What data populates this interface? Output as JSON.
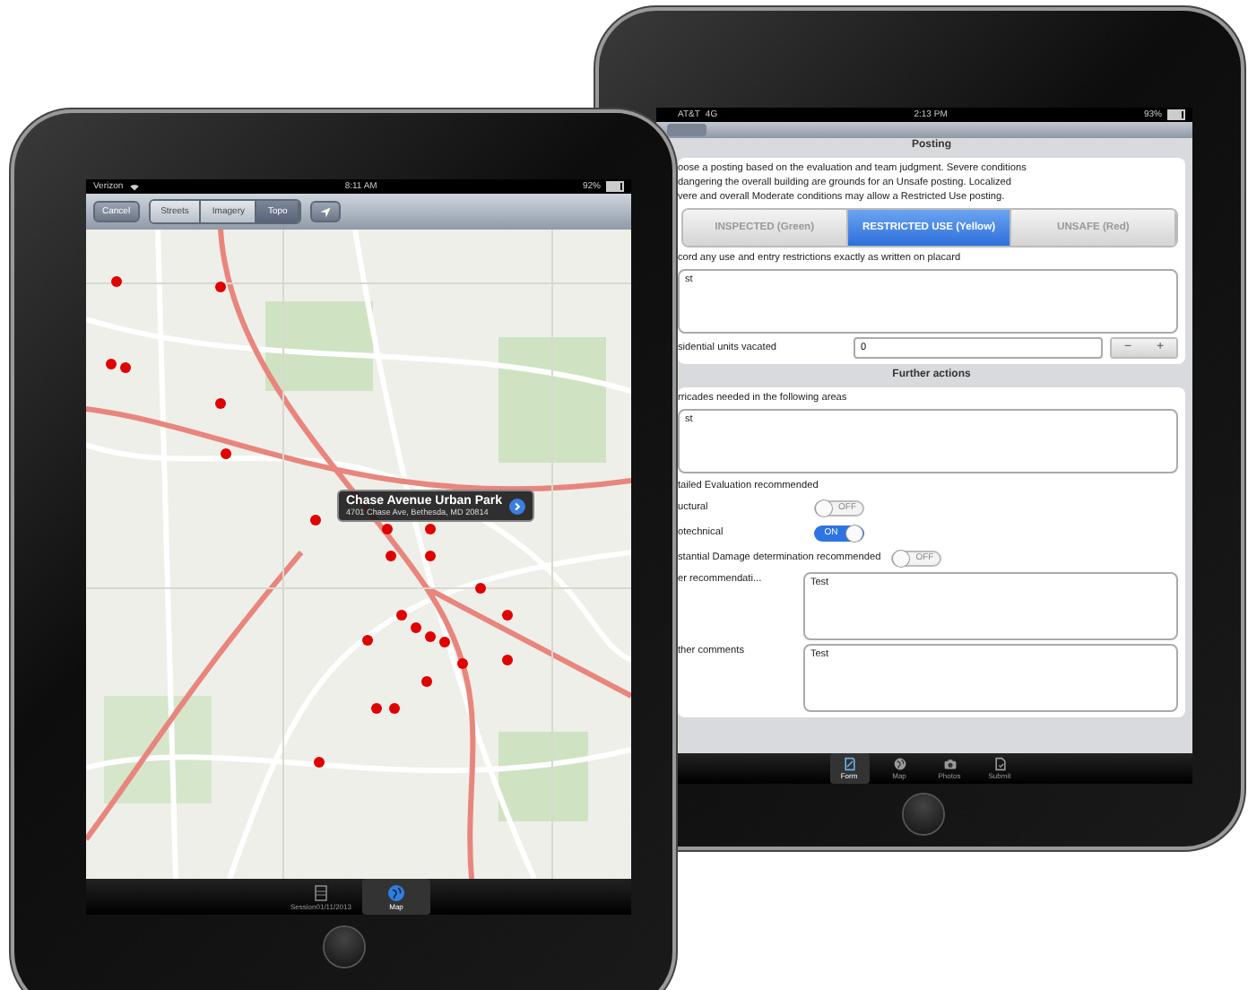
{
  "back_device": {
    "status_bar": {
      "carrier": "AT&T",
      "network": "4G",
      "time": "2:13 PM",
      "battery": "93%"
    },
    "posting": {
      "title": "Posting",
      "instruction_lines": [
        "oose a posting based on the evaluation and team judgment. Severe conditions",
        "dangering the overall building are grounds for an Unsafe posting. Localized",
        "vere and overall Moderate conditions may allow a Restricted Use posting."
      ],
      "segments": [
        {
          "label": "INSPECTED (Green)",
          "selected": false
        },
        {
          "label": "RESTRICTED USE (Yellow)",
          "selected": true
        },
        {
          "label": "UNSAFE (Red)",
          "selected": false
        }
      ],
      "restrictions": {
        "label": "cord any use and entry restrictions exactly as written on placard",
        "value": "st"
      },
      "units": {
        "label": "sidential units vacated",
        "value": "0",
        "minus": "−",
        "plus": "+"
      }
    },
    "further_actions": {
      "title": "Further actions",
      "barricades": {
        "label": "rricades needed in the following areas",
        "value": "st"
      },
      "evaluation_label": "tailed Evaluation recommended",
      "toggles": [
        {
          "label": "uctural",
          "on": false,
          "text": "OFF"
        },
        {
          "label": "otechnical",
          "on": true,
          "text": "ON"
        },
        {
          "label": "stantial Damage determination recommended",
          "on": false,
          "text": "OFF"
        }
      ],
      "notes": [
        {
          "label": "er recommendati...",
          "value": "Test"
        },
        {
          "label": "ther comments",
          "value": "Test"
        }
      ]
    },
    "tabs": [
      {
        "label": "Form",
        "selected": true
      },
      {
        "label": "Map",
        "selected": false
      },
      {
        "label": "Photos",
        "selected": false
      },
      {
        "label": "Submit",
        "selected": false
      }
    ]
  },
  "front_device": {
    "status_bar": {
      "carrier": "Verizon",
      "time": "8:11 AM",
      "battery": "92%"
    },
    "toolbar": {
      "cancel": "Cancel",
      "layers": [
        {
          "label": "Streets",
          "selected": false
        },
        {
          "label": "Imagery",
          "selected": false
        },
        {
          "label": "Topo",
          "selected": true
        }
      ]
    },
    "callout": {
      "title": "Chase Avenue Urban Park",
      "address": "4701 Chase Ave, Bethesda, MD 20814"
    },
    "tabs": [
      {
        "label": "Session01/11/2013",
        "selected": false
      },
      {
        "label": "Map",
        "selected": true
      }
    ]
  }
}
